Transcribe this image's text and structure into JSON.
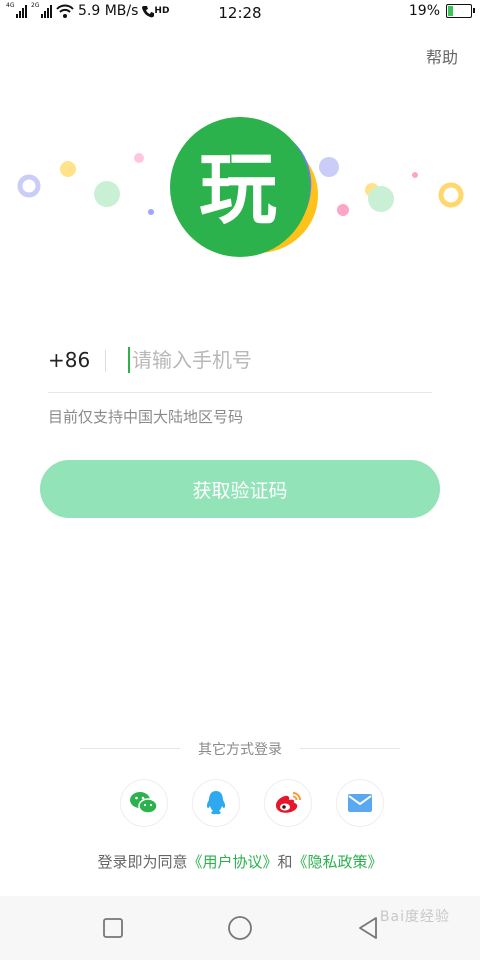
{
  "status_bar": {
    "net1": "4G",
    "net2": "2G",
    "speed": "5.9 MB/s",
    "hd": "HD",
    "time": "12:28",
    "battery": "19%",
    "battery_level": 0.19
  },
  "header": {
    "help": "帮助"
  },
  "logo": {
    "char": "玩"
  },
  "login": {
    "country_code": "+86",
    "phone_placeholder": "请输入手机号",
    "hint": "目前仅支持中国大陆地区号码",
    "get_code": "获取验证码"
  },
  "other_login": {
    "title": "其它方式登录",
    "methods": [
      "wechat-icon",
      "qq-icon",
      "weibo-icon",
      "email-icon"
    ]
  },
  "agreement": {
    "prefix": "登录即为同意",
    "user_agreement": "《用户协议》",
    "and": "和",
    "privacy": "《隐私政策》"
  },
  "watermark": "Bai度经验",
  "colors": {
    "brand_green": "#2bb24c",
    "button_green": "#92e3b8",
    "logo_pink": "#ff5fa6",
    "logo_yellow": "#ffc21a",
    "logo_blue": "#6a7df6"
  }
}
